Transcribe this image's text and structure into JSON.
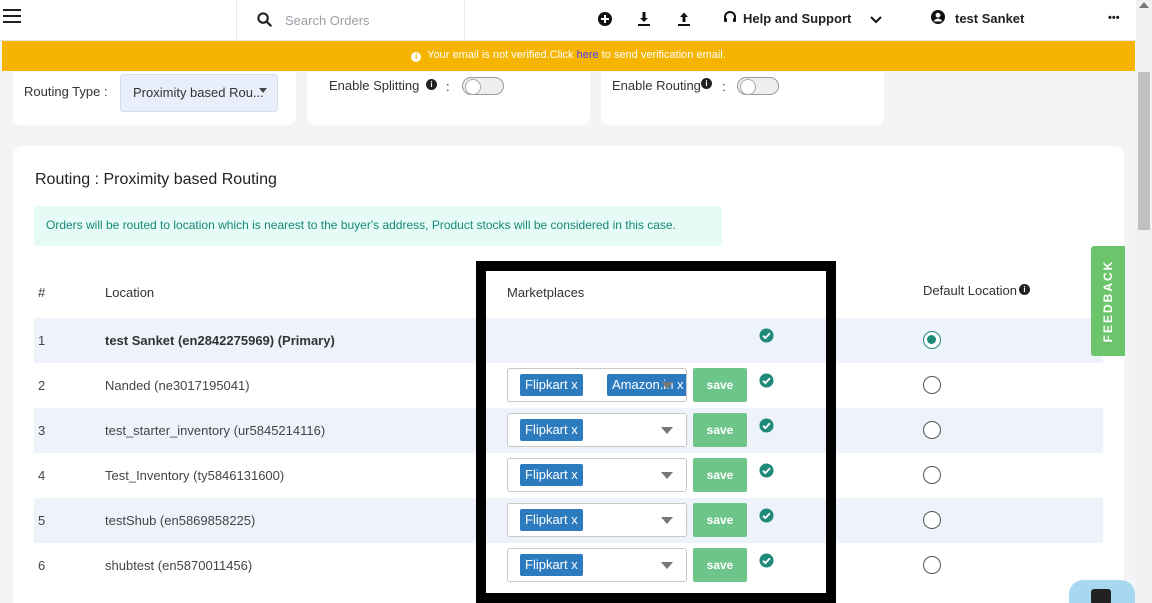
{
  "topbar": {
    "search_placeholder": "Search Orders",
    "help_label": "Help and Support",
    "user_name": "test Sanket",
    "more": "•••"
  },
  "banner": {
    "icon": "i",
    "text_before": "Your email is not verified.Click ",
    "link_text": "here",
    "text_after": " to send verification email."
  },
  "settings": {
    "routing_type_label": "Routing Type :",
    "routing_type_value": "Proximity based Rou...",
    "enable_splitting_label": "Enable Splitting",
    "enable_routing_label": "Enable Routing",
    "colon": ":"
  },
  "routing": {
    "title": "Routing : Proximity based Routing",
    "alert": "Orders will be routed to location which is nearest to the buyer's address, Product stocks will be considered in this case."
  },
  "table": {
    "headers": {
      "num": "#",
      "location": "Location",
      "marketplaces": "Marketplaces",
      "default_location": "Default Location"
    },
    "save_label": "save",
    "rows": [
      {
        "num": "1",
        "location": "test Sanket (en2842275969) (Primary)",
        "chips": [],
        "default": true
      },
      {
        "num": "2",
        "location": "Nanded (ne3017195041)",
        "chips": [
          "Flipkart x",
          "Amazon.in x"
        ],
        "default": false
      },
      {
        "num": "3",
        "location": "test_starter_inventory (ur5845214116)",
        "chips": [
          "Flipkart x"
        ],
        "default": false
      },
      {
        "num": "4",
        "location": "Test_Inventory (ty5846131600)",
        "chips": [
          "Flipkart x"
        ],
        "default": false
      },
      {
        "num": "5",
        "location": "testShub (en5869858225)",
        "chips": [
          "Flipkart x"
        ],
        "default": false
      },
      {
        "num": "6",
        "location": "shubtest (en5870011456)",
        "chips": [
          "Flipkart x"
        ],
        "default": false
      }
    ]
  },
  "feedback_label": "FEEDBACK",
  "colors": {
    "banner": "#f5b400",
    "chip": "#2d7bbf",
    "save": "#6dc58a",
    "teal": "#1f8a7a",
    "feedback": "#6cc46b"
  }
}
